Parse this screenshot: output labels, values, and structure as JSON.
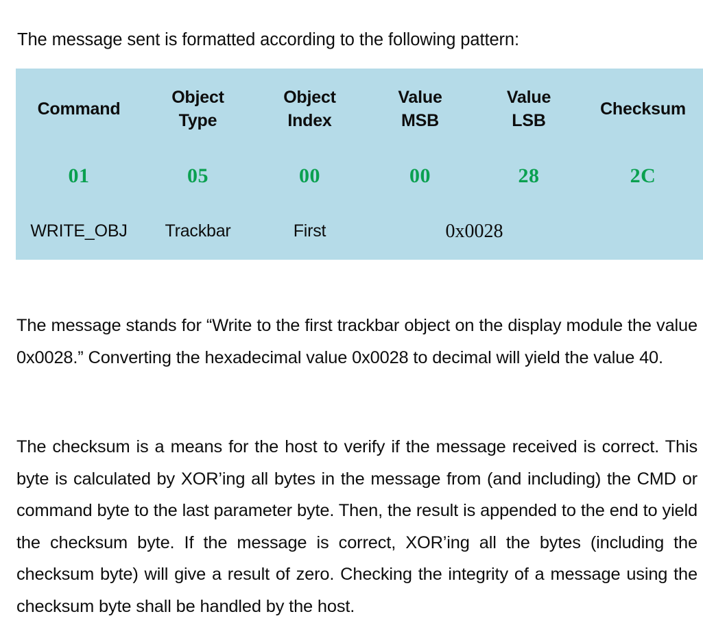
{
  "document": {
    "intro_line": "The message sent is formatted according to the following pattern:",
    "colors": {
      "table_background": "#b5dbe8",
      "hex_value_green": "#0aa050",
      "text_black": "#0d0d0d",
      "page_background": "#ffffff"
    }
  },
  "packet_table": {
    "headers": [
      {
        "line1": "Command",
        "line2": ""
      },
      {
        "line1": "Object",
        "line2": "Type"
      },
      {
        "line1": "Object",
        "line2": "Index"
      },
      {
        "line1": "Value",
        "line2": "MSB"
      },
      {
        "line1": "Value",
        "line2": "LSB"
      },
      {
        "line1": "Checksum",
        "line2": ""
      }
    ],
    "hex_values": [
      "01",
      "05",
      "00",
      "00",
      "28",
      "2C"
    ],
    "descriptions": {
      "command": "WRITE_OBJ",
      "object_type": "Trackbar",
      "object_index": "First",
      "value_merged": "0x0028",
      "checksum": ""
    }
  },
  "paragraphs": [
    "The message stands for “Write to the first trackbar object on the display module the value 0x0028.” Converting the hexadecimal value 0x0028 to decimal will yield the value 40.",
    "The checksum is a means for the host to verify if the message received is correct. This byte is calculated by XOR’ing all bytes in the message from (and including) the CMD or command byte to the last parameter byte. Then, the result is appended to the end to yield the checksum byte. If the message is correct, XOR’ing all the bytes (including the checksum byte) will give a result of zero. Checking the integrity of a message using the checksum byte shall be handled by the host."
  ]
}
